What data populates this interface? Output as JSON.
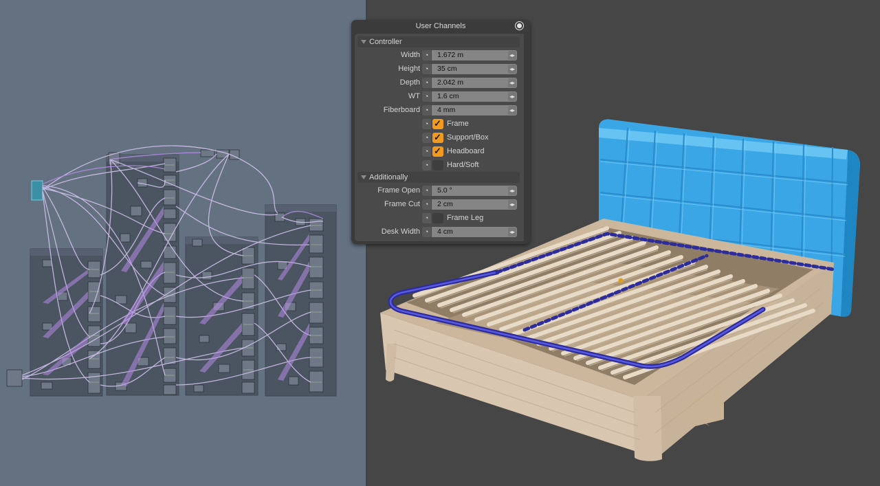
{
  "panel": {
    "title": "User Channels",
    "sections": {
      "controller": "Controller",
      "additionally": "Additionally"
    },
    "channels": {
      "width": {
        "label": "Width",
        "value": "1.672 m"
      },
      "height": {
        "label": "Height",
        "value": "35 cm"
      },
      "depth": {
        "label": "Depth",
        "value": "2.042 m"
      },
      "wt": {
        "label": "WT",
        "value": "1.6 cm"
      },
      "fiberboard": {
        "label": "Fiberboard",
        "value": "4 mm"
      },
      "frame_open": {
        "label": "Frame Open",
        "value": "5.0 °"
      },
      "frame_cut": {
        "label": "Frame Cut",
        "value": "2 cm"
      },
      "desk_width": {
        "label": "Desk Width",
        "value": "4 cm"
      }
    },
    "toggles": {
      "frame": {
        "label": "Frame",
        "checked": true
      },
      "support_box": {
        "label": "Support/Box",
        "checked": true
      },
      "headboard": {
        "label": "Headboard",
        "checked": true
      },
      "hard_soft": {
        "label": "Hard/Soft",
        "checked": false
      },
      "frame_leg": {
        "label": "Frame Leg",
        "checked": false
      }
    }
  },
  "colors": {
    "node_editor_bg": "#647180",
    "viewport_bg": "#464646",
    "checkbox_accent": "#f29a1e",
    "headboard_blue": "#3aa6e6",
    "frame_tube_blue": "#3838b8",
    "wood": "#d8c6b0",
    "wire_lilac": "#d6c6f2",
    "wire_purple": "#b58ce6"
  },
  "icons": {
    "channel_key": "key-icon",
    "close": "close-icon",
    "collapse": "triangle-down-icon",
    "spinner": "spinner-arrows-icon",
    "check": "checkmark-icon"
  }
}
